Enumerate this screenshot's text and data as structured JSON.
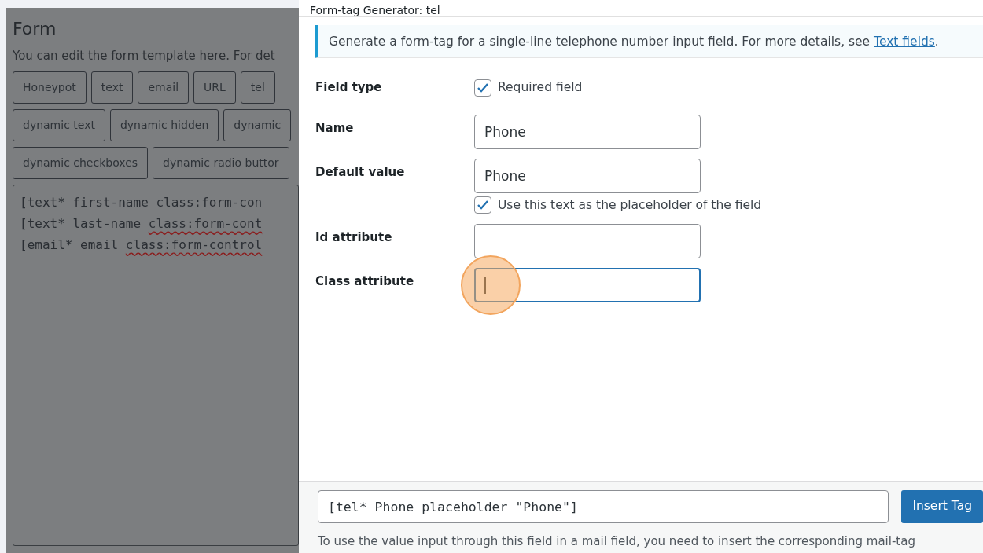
{
  "background_page": {
    "title": "Form",
    "description": "You can edit the form template here. For det",
    "tag_buttons": [
      [
        "Honeypot",
        "text",
        "email",
        "URL",
        "tel"
      ],
      [
        "dynamic text",
        "dynamic hidden",
        "dynamic"
      ],
      [
        "dynamic checkboxes",
        "dynamic radio buttor"
      ]
    ],
    "template_lines": [
      {
        "text": "[text* first-name class:form-con"
      },
      {
        "text": "[text* last-name ",
        "underlined": "class:form-cont"
      },
      {
        "text": "[email* email ",
        "underlined": "class:form-control"
      }
    ]
  },
  "dialog": {
    "title": "Form-tag Generator: tel",
    "notice": {
      "text": "Generate a form-tag for a single-line telephone number input field. For more details, see ",
      "link": "Text fields",
      "after": "."
    },
    "rows": [
      {
        "label": "Field type",
        "kind": "checkbox",
        "checkbox": {
          "label": "Required field",
          "checked": true
        }
      },
      {
        "label": "Name",
        "kind": "input",
        "value": "Phone",
        "focused": false
      },
      {
        "label": "Default value",
        "kind": "input",
        "value": "Phone",
        "focused": false,
        "checkbox": {
          "label": "Use this text as the placeholder of the field",
          "checked": true
        }
      },
      {
        "label": "Id attribute",
        "kind": "input",
        "value": "",
        "focused": false
      },
      {
        "label": "Class attribute",
        "kind": "input",
        "value": "",
        "focused": true
      }
    ],
    "tag_output": "[tel* Phone placeholder \"Phone\"]",
    "insert_button": "Insert Tag",
    "footer_text": "To use the value input through this field in a mail field, you need to insert the corresponding mail-tag"
  }
}
